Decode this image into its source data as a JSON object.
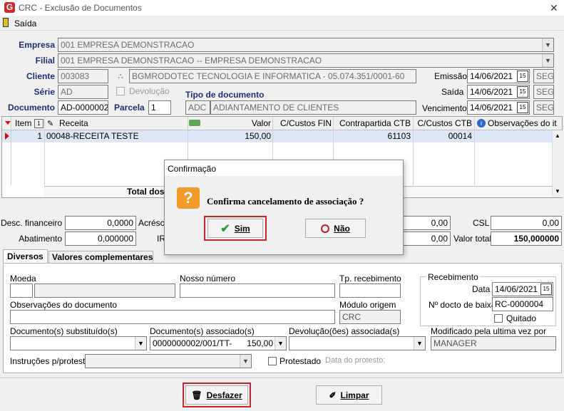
{
  "window": {
    "title": "CRC - Exclusão de Documentos",
    "close_glyph": "✕"
  },
  "menu": {
    "exit_label": "Saída"
  },
  "header": {
    "empresa_label": "Empresa",
    "empresa_value": "001 EMPRESA DEMONSTRACAO",
    "filial_label": "Filial",
    "filial_value": "001 EMPRESA DEMONSTRACAO -- EMPRESA DEMONSTRACAO",
    "cliente_label": "Cliente",
    "cliente_code": "003083",
    "cliente_name": "BGMRODOTEC TECNOLOGIA  E INFORMATICA - 05.074.351/0001-60",
    "serie_label": "Série",
    "serie_value": "AD",
    "devolucao_label": "Devolução",
    "documento_label": "Documento",
    "documento_value": "AD-0000002",
    "parcela_label": "Parcela",
    "parcela_value": "1",
    "tipo_label": "Tipo de documento",
    "tipo_code": "ADC",
    "tipo_name": "ADIANTAMENTO DE CLIENTES",
    "emissao_label": "Emissão",
    "emissao_value": "14/06/2021",
    "emissao_day": "SEG",
    "saida_label": "Saída",
    "saida_value": "14/06/2021",
    "saida_day": "SEG",
    "vencimento_label": "Vencimento",
    "vencimento_value": "14/06/2021",
    "vencimento_day": "SEG"
  },
  "grid": {
    "columns": [
      "Item",
      "Receita",
      "Valor",
      "C/Custos FIN",
      "Contrapartida CTB",
      "C/Custos CTB",
      "Observações do it"
    ],
    "rows": [
      {
        "item": "1",
        "receita": "00048-RECEITA TESTE",
        "valor": "150,00",
        "cc_fin": "",
        "contrapartida": "61103",
        "cc_ctb": "00014",
        "obs": ""
      }
    ],
    "total_label": "Total dos"
  },
  "totals": {
    "desc_fin_label": "Desc. financeiro",
    "desc_fin_value": "0,0000",
    "acresc_label": "Acrésci",
    "abatimento_label": "Abatimento",
    "abatimento_value": "0,000000",
    "ir_label": "IR",
    "mid1_value": "0,00",
    "mid2_value": "0,00",
    "csl_label": "CSL",
    "csl_value": "0,00",
    "valor_total_label": "Valor total",
    "valor_total_value": "150,000000"
  },
  "tabs": [
    "Diversos",
    "Valores complementares"
  ],
  "diversos": {
    "moeda_label": "Moeda",
    "nosso_numero_label": "Nosso número",
    "tp_recebimento_label": "Tp. recebimento",
    "recebimento_group": "Recebimento",
    "data_label": "Data",
    "data_value": "14/06/2021",
    "docto_baixa_label": "Nº docto de baixa",
    "docto_baixa_value": "RC-0000004",
    "quitado_label": "Quitado",
    "obs_label": "Observações do documento",
    "modulo_label": "Módulo origem",
    "modulo_value": "CRC",
    "doc_subst_label": "Documento(s) substituído(s)",
    "doc_assoc_label": "Documento(s) associado(s)",
    "doc_assoc_value": "0000000002/001/TT-",
    "doc_assoc_amount": "150,00",
    "devol_label": "Devolução(ões) associada(s)",
    "modificado_label": "Modificado pela ultima vez por",
    "modificado_value": "MANAGER",
    "instrucoes_label": "Instruções p/protesto",
    "protestado_label": "Protestado",
    "data_protesto_label": "Data do protesto:"
  },
  "footer": {
    "desfazer_label": "Desfazer",
    "limpar_label": "Limpar"
  },
  "dialog": {
    "title": "Confirmação",
    "message": "Confirma cancelamento de associação ?",
    "yes_label": "Sim",
    "no_label": "Não"
  },
  "colors": {
    "label_blue": "#1e2f78",
    "highlight_red": "#c0282d",
    "logo_red": "#d12a2a"
  }
}
